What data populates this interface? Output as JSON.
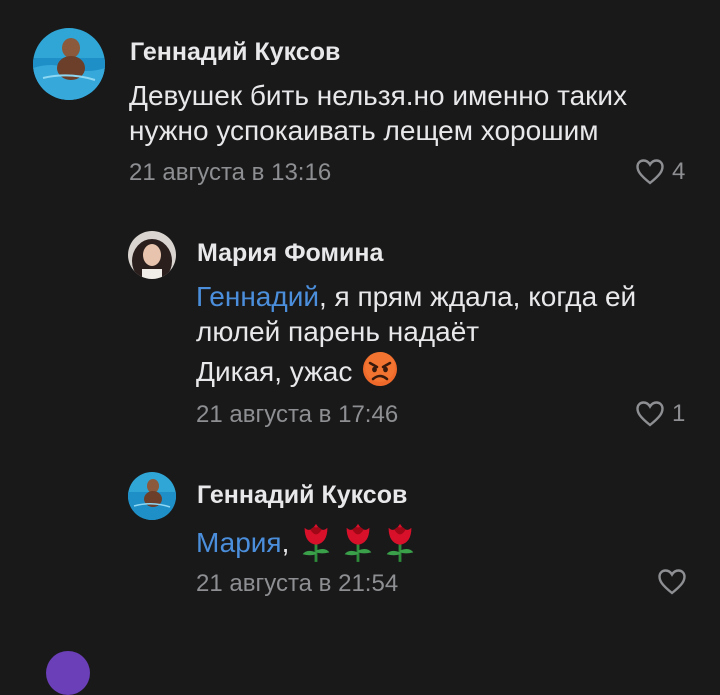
{
  "comments": [
    {
      "author": "Геннадий Куксов",
      "lines": [
        "Девушек бить нельзя.но именно таких",
        "нужно успокаивать лещем хорошим"
      ],
      "timestamp": "21 августа в 13:16",
      "likes": "4",
      "avatar_icon": "pool-avatar-icon"
    },
    {
      "author": "Мария Фомина",
      "mention": "Геннадий",
      "line1_rest": ", я прям ждала, когда ей",
      "line2": "люлей парень надаёт",
      "line3": "Дикая, ужас",
      "emoji_icon": "angry-face-icon",
      "timestamp": "21 августа в 17:46",
      "likes": "1",
      "avatar_icon": "girl-avatar-icon"
    },
    {
      "author": "Геннадий Куксов",
      "mention": "Мария",
      "text_rest": ",",
      "roses_icon": "rose-icon",
      "rose_count": 3,
      "timestamp": "21 августа в 21:54",
      "likes": "",
      "avatar_icon": "pool-avatar-icon"
    }
  ],
  "colors": {
    "background": "#19191a",
    "text": "#e8e8ea",
    "secondary": "#8e8f92",
    "mention": "#4b8fdc"
  }
}
